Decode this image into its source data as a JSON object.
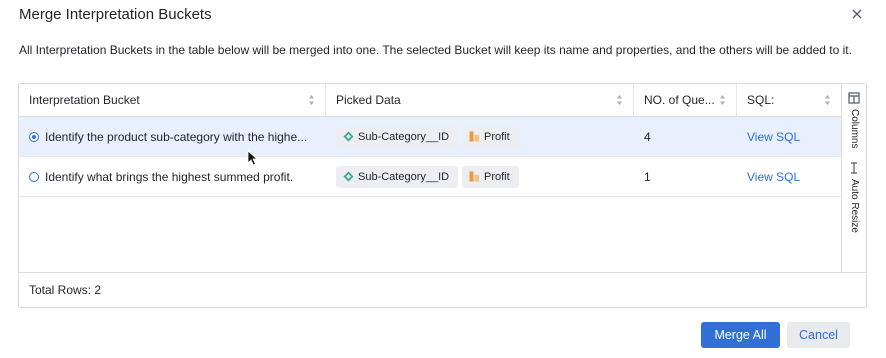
{
  "dialog": {
    "title": "Merge Interpretation Buckets",
    "description": "All Interpretation Buckets in the table below will be merged into one. The selected Bucket will keep its name and properties, and the others will be added to it."
  },
  "table": {
    "columns": [
      "Interpretation Bucket",
      "Picked Data",
      "NO. of Que...",
      "SQL:"
    ],
    "rows": [
      {
        "selected": true,
        "bucket": "Identify the product sub-category with the highe...",
        "picked": [
          {
            "label": "Sub-Category__ID",
            "icon": "dimension-diamond-icon"
          },
          {
            "label": "Profit",
            "icon": "measure-bar-icon"
          }
        ],
        "questions": "4",
        "sql": "View SQL"
      },
      {
        "selected": false,
        "bucket": "Identify what brings the highest summed profit.",
        "picked": [
          {
            "label": "Sub-Category__ID",
            "icon": "dimension-diamond-icon"
          },
          {
            "label": "Profit",
            "icon": "measure-bar-icon"
          }
        ],
        "questions": "1",
        "sql": "View SQL"
      }
    ],
    "side_panel": {
      "columns": "Columns",
      "auto_resize": "Auto Resize"
    },
    "footer": "Total Rows: 2"
  },
  "buttons": {
    "merge_all": "Merge All",
    "cancel": "Cancel"
  },
  "colors": {
    "accent": "#2f6fd6",
    "selected_row": "#e8f0fd",
    "chip_bg": "#eceef1",
    "dimension_icon": "#3aa88f",
    "measure_icon": "#e89a3c"
  }
}
